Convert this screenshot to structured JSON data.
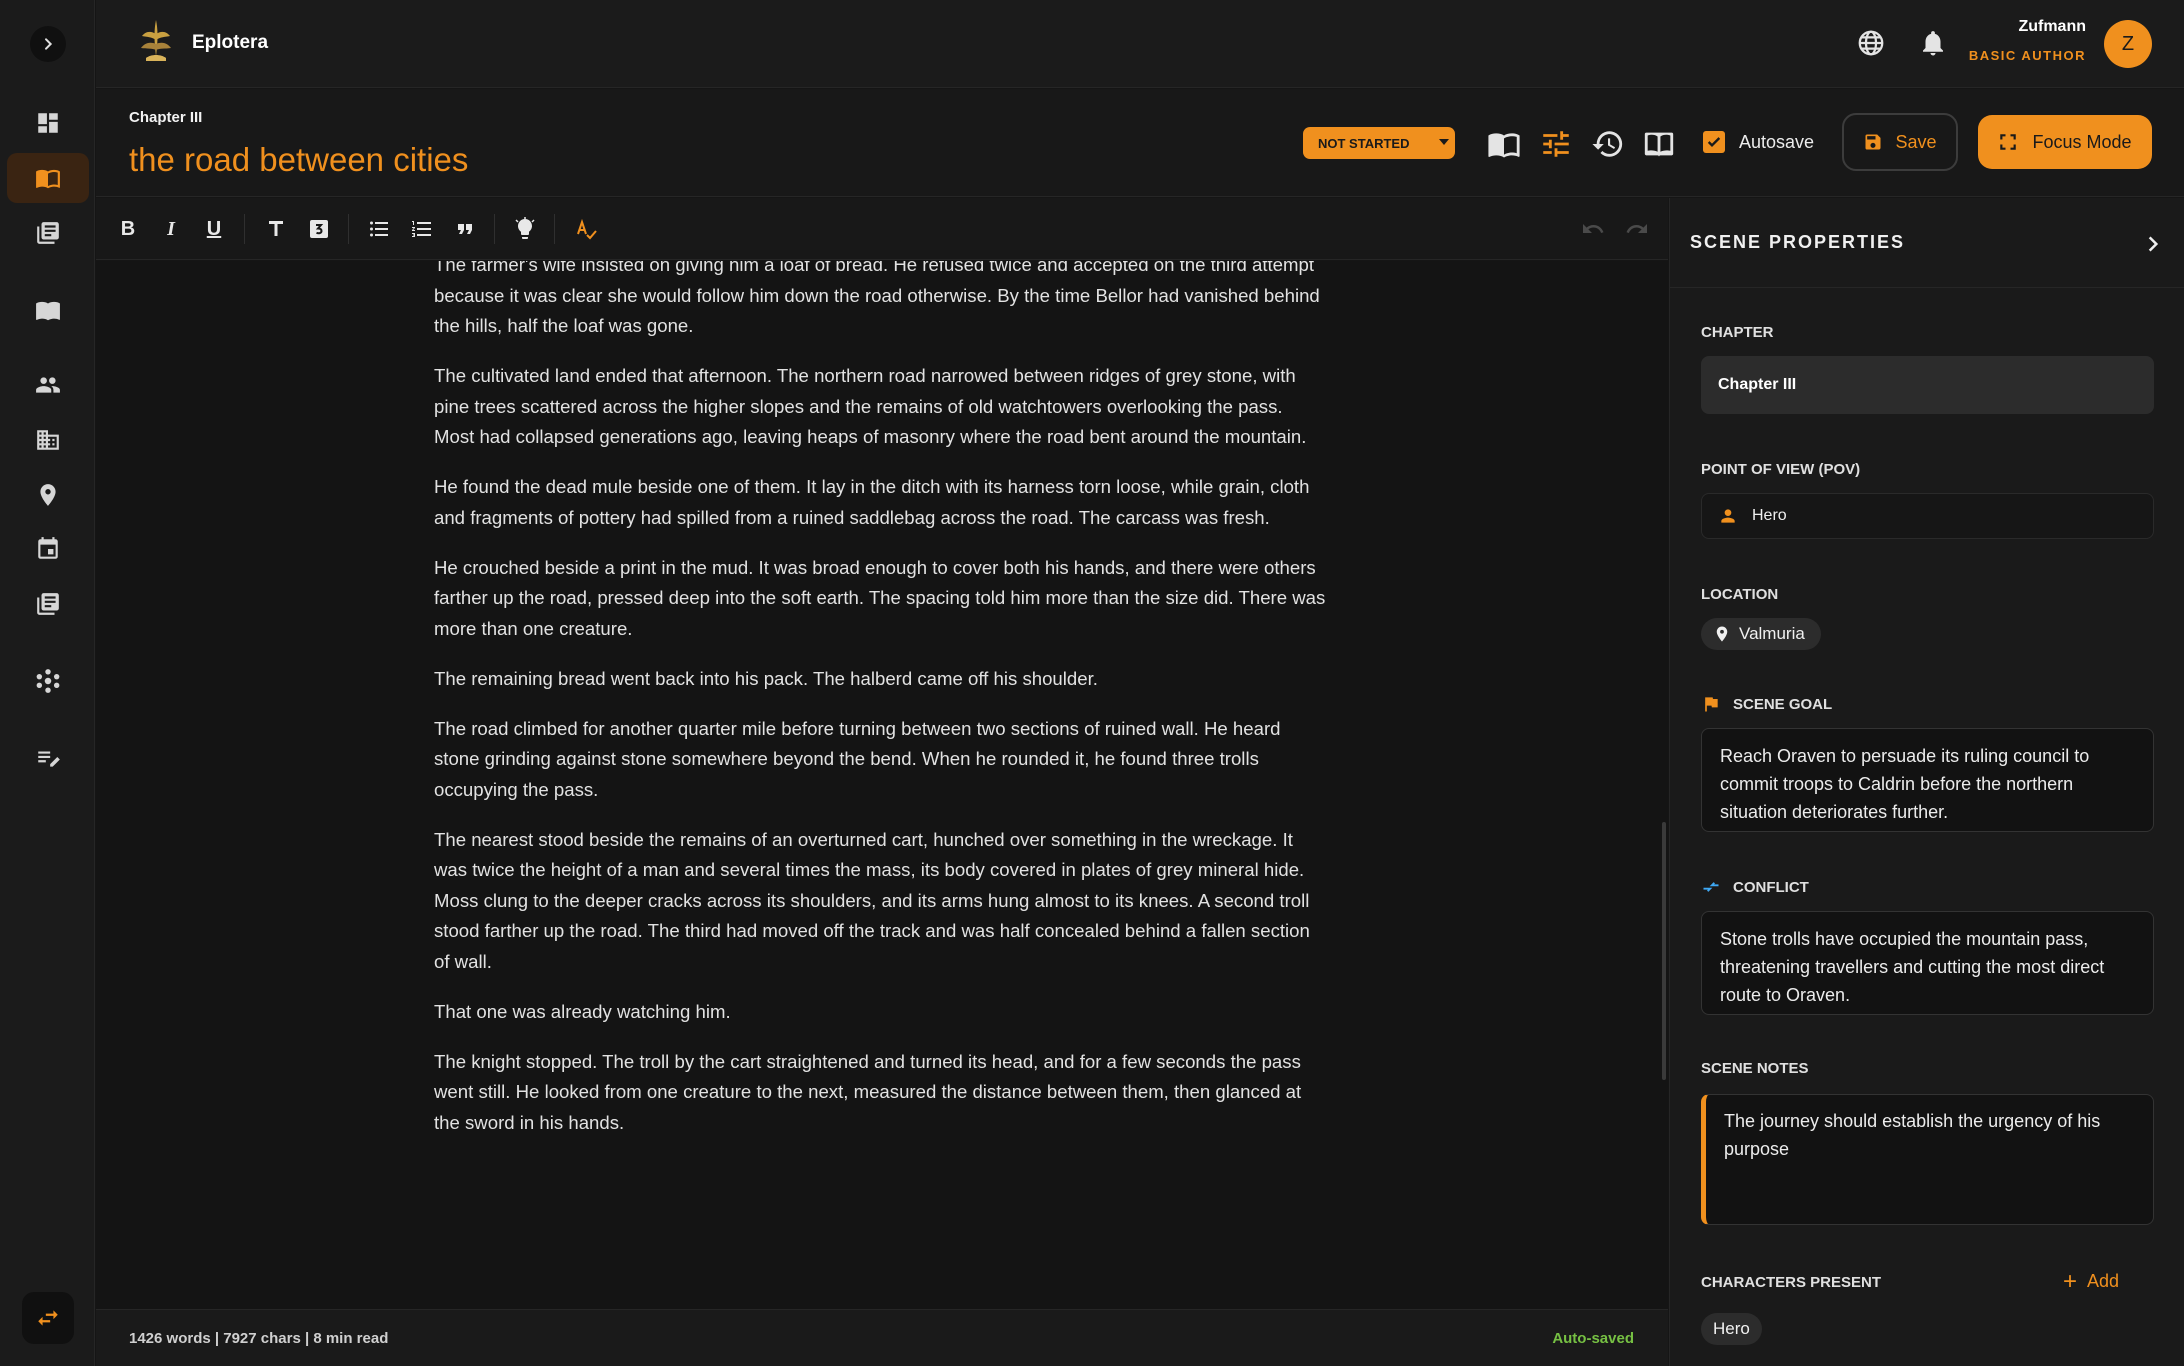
{
  "app": {
    "name": "Eplotera"
  },
  "user": {
    "name": "Zufmann",
    "role": "BASIC AUTHOR",
    "initial": "Z"
  },
  "header": {
    "chapter": "Chapter III",
    "scene_title": "the road between cities",
    "status": "NOT STARTED",
    "autosave_label": "Autosave",
    "autosave_checked": true,
    "save_label": "Save",
    "focus_label": "Focus Mode"
  },
  "editor": {
    "paragraphs": [
      "The farmer's wife insisted on giving him a loaf of bread. He refused twice and accepted on the third attempt because it was clear she would follow him down the road otherwise. By the time Bellor had vanished behind the hills, half the loaf was gone.",
      "The cultivated land ended that afternoon. The northern road narrowed between ridges of grey stone, with pine trees scattered across the higher slopes and the remains of old watchtowers overlooking the pass. Most had collapsed generations ago, leaving heaps of masonry where the road bent around the mountain.",
      "He found the dead mule beside one of them. It lay in the ditch with its harness torn loose, while grain, cloth and fragments of pottery had spilled from a ruined saddlebag across the road. The carcass was fresh.",
      "He crouched beside a print in the mud. It was broad enough to cover both his hands, and there were others farther up the road, pressed deep into the soft earth. The spacing told him more than the size did. There was more than one creature.",
      "The remaining bread went back into his pack. The halberd came off his shoulder.",
      "The road climbed for another quarter mile before turning between two sections of ruined wall. He heard stone grinding against stone somewhere beyond the bend. When he rounded it, he found three trolls occupying the pass.",
      "The nearest stood beside the remains of an overturned cart, hunched over something in the wreckage. It was twice the height of a man and several times the mass, its body covered in plates of grey mineral hide. Moss clung to the deeper cracks across its shoulders, and its arms hung almost to its knees. A second troll stood farther up the road. The third had moved off the track and was half concealed behind a fallen section of wall.",
      "That one was already watching him.",
      "The knight stopped. The troll by the cart straightened and turned its head, and for a few seconds the pass went still. He looked from one creature to the next, measured the distance between them, then glanced at the sword in his hands."
    ]
  },
  "footer": {
    "stats": "1426 words | 7927 chars | 8 min read",
    "saved": "Auto-saved"
  },
  "panel": {
    "title": "SCENE PROPERTIES",
    "chapter_label": "CHAPTER",
    "chapter_value": "Chapter III",
    "pov_label": "POINT OF VIEW (POV)",
    "pov_value": "Hero",
    "location_label": "LOCATION",
    "location_value": "Valmuria",
    "goal_label": "SCENE GOAL",
    "goal_text": "Reach Oraven to persuade its ruling council to commit troops to Caldrin before the northern situation deteriorates further.",
    "conflict_label": "CONFLICT",
    "conflict_text": "Stone trolls have occupied the mountain pass, threatening travellers and cutting the most direct route to Oraven.",
    "notes_label": "SCENE NOTES",
    "notes_text": "The journey should establish the urgency of his purpose",
    "characters_label": "CHARACTERS PRESENT",
    "add_label": "Add",
    "characters": [
      "Hero"
    ]
  },
  "colors": {
    "accent": "#f0901e",
    "background": "#151515",
    "panel": "#1a1a1a",
    "saved": "#76c043",
    "conflict_icon": "#3fa9f5"
  }
}
